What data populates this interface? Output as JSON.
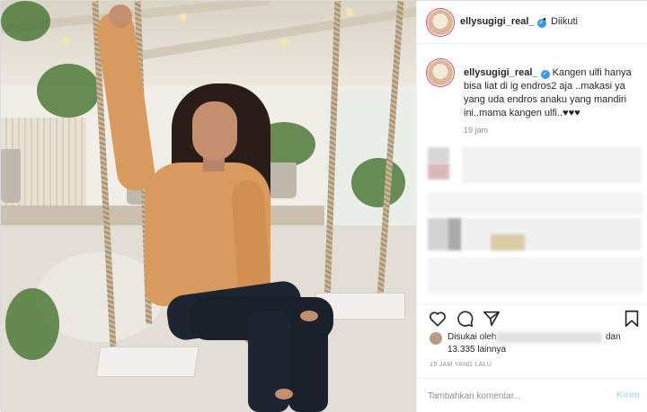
{
  "post": {
    "photo_icon": "photo-of-woman-on-rope-swing",
    "author": {
      "username": "ellysugigi_real_",
      "verified_icon": "verified-badge-icon",
      "verified_color": "#3897f0"
    },
    "header": {
      "separator": "•",
      "follow_status": "Diikuti"
    },
    "caption": {
      "username": "ellysugigi_real_",
      "text": "Kangen ulfi hanya bisa liat di ig endros2 aja ..makasi ya yang uda endros anaku yang mandiri ini..mama kangen ulfi..♥♥♥",
      "time": "19 jam"
    },
    "actions": {
      "like_icon": "heart-icon",
      "comment_icon": "comment-icon",
      "share_icon": "share-icon",
      "save_icon": "bookmark-icon"
    },
    "likes": {
      "prefix": "Disukai oleh",
      "and": "dan",
      "count": "13.335 lainnya"
    },
    "posted_ago": "19 JAM YANG LALU",
    "comment_box": {
      "placeholder": "Tambahkan komentar...",
      "send_label": "Kirim",
      "send_color": "#b2dffc"
    }
  }
}
